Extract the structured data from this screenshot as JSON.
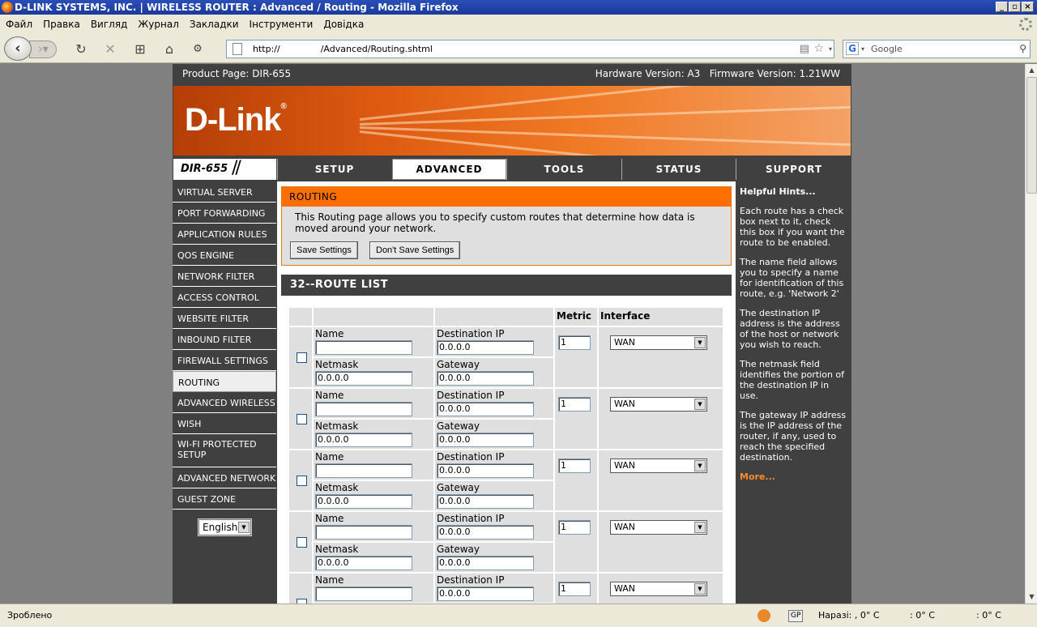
{
  "window": {
    "title": "D-LINK SYSTEMS, INC. | WIRELESS ROUTER : Advanced / Routing - Mozilla Firefox"
  },
  "menu": [
    "Файл",
    "Правка",
    "Вигляд",
    "Журнал",
    "Закладки",
    "Інструменти",
    "Довідка"
  ],
  "nav": {
    "url_prefix": "http://",
    "url_suffix": "/Advanced/Routing.shtml",
    "search_placeholder": "Google"
  },
  "status": {
    "left": "Зроблено",
    "gp": "GP",
    "weather": "Наразі: , 0° C",
    "temp2": ": 0° C",
    "temp3": ": 0° C"
  },
  "router": {
    "product": "Product Page: DIR-655",
    "version": "Hardware Version: A3   Firmware Version: 1.21WW",
    "logo": "D-Link",
    "model": "DIR-655",
    "tabs": [
      "SETUP",
      "ADVANCED",
      "TOOLS",
      "STATUS",
      "SUPPORT"
    ],
    "active_tab": "ADVANCED",
    "sidebar": [
      "VIRTUAL SERVER",
      "PORT FORWARDING",
      "APPLICATION RULES",
      "QOS ENGINE",
      "NETWORK FILTER",
      "ACCESS CONTROL",
      "WEBSITE FILTER",
      "INBOUND FILTER",
      "FIREWALL SETTINGS",
      "ROUTING",
      "ADVANCED WIRELESS",
      "WISH",
      "WI-FI PROTECTED SETUP",
      "ADVANCED NETWORK",
      "GUEST ZONE"
    ],
    "selected_sidebar": "ROUTING",
    "language": "English",
    "routing": {
      "header": "ROUTING",
      "description": "This Routing page allows you to specify custom routes that determine how data is moved around your network.",
      "save": "Save Settings",
      "dont_save": "Don't Save Settings"
    },
    "route_list": {
      "header": "32--ROUTE LIST",
      "col_metric": "Metric",
      "col_interface": "Interface",
      "lbl_name": "Name",
      "lbl_dest": "Destination IP",
      "lbl_netmask": "Netmask",
      "lbl_gateway": "Gateway",
      "rows": [
        {
          "name": "",
          "dest": "0.0.0.0",
          "netmask": "0.0.0.0",
          "gateway": "0.0.0.0",
          "metric": "1",
          "iface": "WAN"
        },
        {
          "name": "",
          "dest": "0.0.0.0",
          "netmask": "0.0.0.0",
          "gateway": "0.0.0.0",
          "metric": "1",
          "iface": "WAN"
        },
        {
          "name": "",
          "dest": "0.0.0.0",
          "netmask": "0.0.0.0",
          "gateway": "0.0.0.0",
          "metric": "1",
          "iface": "WAN"
        },
        {
          "name": "",
          "dest": "0.0.0.0",
          "netmask": "0.0.0.0",
          "gateway": "0.0.0.0",
          "metric": "1",
          "iface": "WAN"
        },
        {
          "name": "",
          "dest": "0.0.0.0",
          "netmask": "",
          "gateway": "",
          "metric": "1",
          "iface": "WAN"
        }
      ]
    },
    "hints": {
      "title": "Helpful Hints...",
      "paragraphs": [
        "Each route has a check box next to it, check this box if you want the route to be enabled.",
        "The name field allows you to specify a name for identification of this route, e.g. 'Network 2'",
        "The destination IP address is the address of the host or network you wish to reach.",
        "The netmask field identifies the portion of the destination IP in use.",
        "The gateway IP address is the IP address of the router, if any, used to reach the specified destination."
      ],
      "more": "More..."
    }
  }
}
